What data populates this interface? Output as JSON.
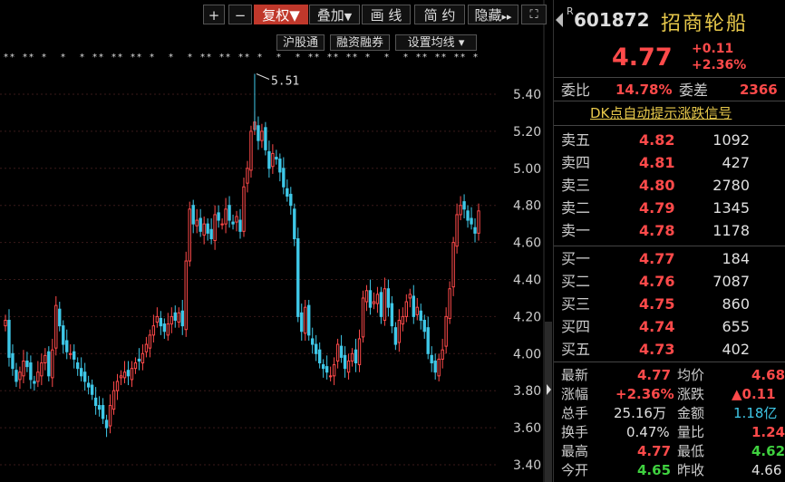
{
  "toolbar": {
    "plus": "+",
    "minus": "−",
    "fq": "复权",
    "fq_arrow": "▼",
    "overlay": "叠加",
    "overlay_arrow": "▼",
    "draw": "画 线",
    "simple": "简 约",
    "hide": "隐藏",
    "hide_arrow": "▸▸",
    "full": "⛶",
    "hgt": "沪股通",
    "rz": "融资融券",
    "ma": "设置均线",
    "ma_arrow": "▾"
  },
  "chart_data": {
    "type": "candlestick",
    "y_ticks": [
      "5.40",
      "5.20",
      "5.00",
      "4.80",
      "4.60",
      "4.40",
      "4.20",
      "4.00",
      "3.80",
      "3.60",
      "3.40"
    ],
    "ylim": [
      3.4,
      5.45
    ],
    "peak_label": "5.51",
    "peak_value": 5.51,
    "closes": [
      4.18,
      3.98,
      3.92,
      3.85,
      3.9,
      3.96,
      3.93,
      3.86,
      3.84,
      3.9,
      3.95,
      3.99,
      3.88,
      4.02,
      4.26,
      4.15,
      4.05,
      4.01,
      4.0,
      3.97,
      3.92,
      3.88,
      3.85,
      3.82,
      3.78,
      3.72,
      3.7,
      3.65,
      3.6,
      3.72,
      3.8,
      3.85,
      3.88,
      3.9,
      3.88,
      3.92,
      3.95,
      3.96,
      4.0,
      4.05,
      4.1,
      4.15,
      4.2,
      4.15,
      4.12,
      4.16,
      4.2,
      4.18,
      4.22,
      4.15,
      4.5,
      4.78,
      4.7,
      4.72,
      4.66,
      4.7,
      4.65,
      4.62,
      4.75,
      4.72,
      4.7,
      4.78,
      4.72,
      4.7,
      4.74,
      4.66,
      4.9,
      5.0,
      5.2,
      5.25,
      5.15,
      5.2,
      5.1,
      5.0,
      5.08,
      5.05,
      4.98,
      4.9,
      4.85,
      4.8,
      4.62,
      4.2,
      4.12,
      4.25,
      4.1,
      4.05,
      4.0,
      3.95,
      3.92,
      3.9,
      3.88,
      3.94,
      4.05,
      3.98,
      3.92,
      3.96,
      4.0,
      3.95,
      4.08,
      4.3,
      4.34,
      4.25,
      4.28,
      4.32,
      4.2,
      4.35,
      4.25,
      4.15,
      4.05,
      4.18,
      4.2,
      4.28,
      4.32,
      4.2,
      4.25,
      4.18,
      4.12,
      4.0,
      3.95,
      3.9,
      3.97,
      4.02,
      4.2,
      4.35,
      4.6,
      4.75,
      4.8,
      4.78,
      4.72,
      4.7,
      4.65,
      4.77
    ],
    "price_color_up": "#ff4a4a",
    "price_color_down": "#3fc8e8"
  },
  "stock": {
    "code_prefix": "R",
    "code": "601872",
    "name": "招商轮船",
    "price": "4.77",
    "change": "+0.11",
    "change_pct": "+2.36%",
    "weibi_label": "委比",
    "weibi_val": "14.78%",
    "weicha_label": "委差",
    "weicha_val": "2366",
    "dk_link": "DK点自动提示涨跌信号"
  },
  "sell": [
    {
      "label": "卖五",
      "price": "4.82",
      "vol": "1092"
    },
    {
      "label": "卖四",
      "price": "4.81",
      "vol": "427"
    },
    {
      "label": "卖三",
      "price": "4.80",
      "vol": "2780"
    },
    {
      "label": "卖二",
      "price": "4.79",
      "vol": "1345"
    },
    {
      "label": "卖一",
      "price": "4.78",
      "vol": "1178"
    }
  ],
  "buy": [
    {
      "label": "买一",
      "price": "4.77",
      "vol": "184"
    },
    {
      "label": "买二",
      "price": "4.76",
      "vol": "7087"
    },
    {
      "label": "买三",
      "price": "4.75",
      "vol": "860"
    },
    {
      "label": "买四",
      "price": "4.74",
      "vol": "655"
    },
    {
      "label": "买五",
      "price": "4.73",
      "vol": "402"
    }
  ],
  "stats": {
    "zx_l": "最新",
    "zx_v": "4.77",
    "jj_l": "均价",
    "jj_v": "4.68",
    "zf_l": "涨幅",
    "zf_v": "+2.36%",
    "zd_l": "涨跌",
    "zd_v": "▲0.11",
    "zs_l": "总手",
    "zs_v": "25.16万",
    "je_l": "金额",
    "je_v": "1.18亿",
    "hs_l": "换手",
    "hs_v": "0.47%",
    "lb_l": "量比",
    "lb_v": "1.24",
    "zg_l": "最高",
    "zg_v": "4.77",
    "zd2_l": "最低",
    "zd2_v": "4.62",
    "jk_l": "今开",
    "jk_v": "4.65",
    "zs2_l": "昨收",
    "zs2_v": "4.66"
  }
}
